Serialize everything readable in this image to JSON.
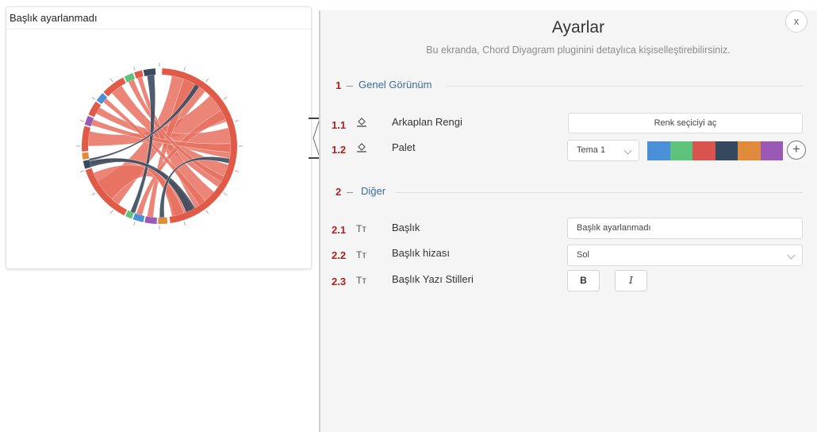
{
  "widget": {
    "title": "Başlık ayarlanmadı"
  },
  "settings": {
    "title": "Ayarlar",
    "subtitle": "Bu ekranda, Chord Diyagram pluginini detaylıca kişiselleştirebilirsiniz.",
    "close_label": "x",
    "sections": [
      {
        "number": "1",
        "title": "Genel Görünüm"
      },
      {
        "number": "2",
        "title": "Diğer"
      }
    ],
    "rows": {
      "background": {
        "number": "1.1",
        "icon": "paint-bucket-icon",
        "label": "Arkaplan Rengi",
        "button": "Renk seçiciyi aç"
      },
      "palette": {
        "number": "1.2",
        "icon": "paint-bucket-icon",
        "label": "Palet",
        "selected": "Tema 1",
        "add_label": "+"
      },
      "title": {
        "number": "2.1",
        "icon": "text-icon",
        "label": "Başlık",
        "value": "Başlık ayarlanmadı"
      },
      "alignment": {
        "number": "2.2",
        "icon": "text-icon",
        "label": "Başlık hizası",
        "selected": "Sol"
      },
      "text_styles": {
        "number": "2.3",
        "icon": "text-icon",
        "label": "Başlık Yazı Stilleri",
        "bold": "B",
        "italic": "I"
      }
    },
    "text_icon_glyph": "Tт",
    "palette_colors": [
      "#4a90d9",
      "#5dc37a",
      "#d9534f",
      "#34495e",
      "#e08a3c",
      "#9b59b6"
    ]
  },
  "chord_colors": {
    "main": "#e05a47",
    "ribbon": "#e8705f",
    "dark": "#3a4a5e",
    "blue": "#4a90d9",
    "green": "#5dc37a",
    "purple": "#9b59b6",
    "orange": "#e08a3c"
  }
}
